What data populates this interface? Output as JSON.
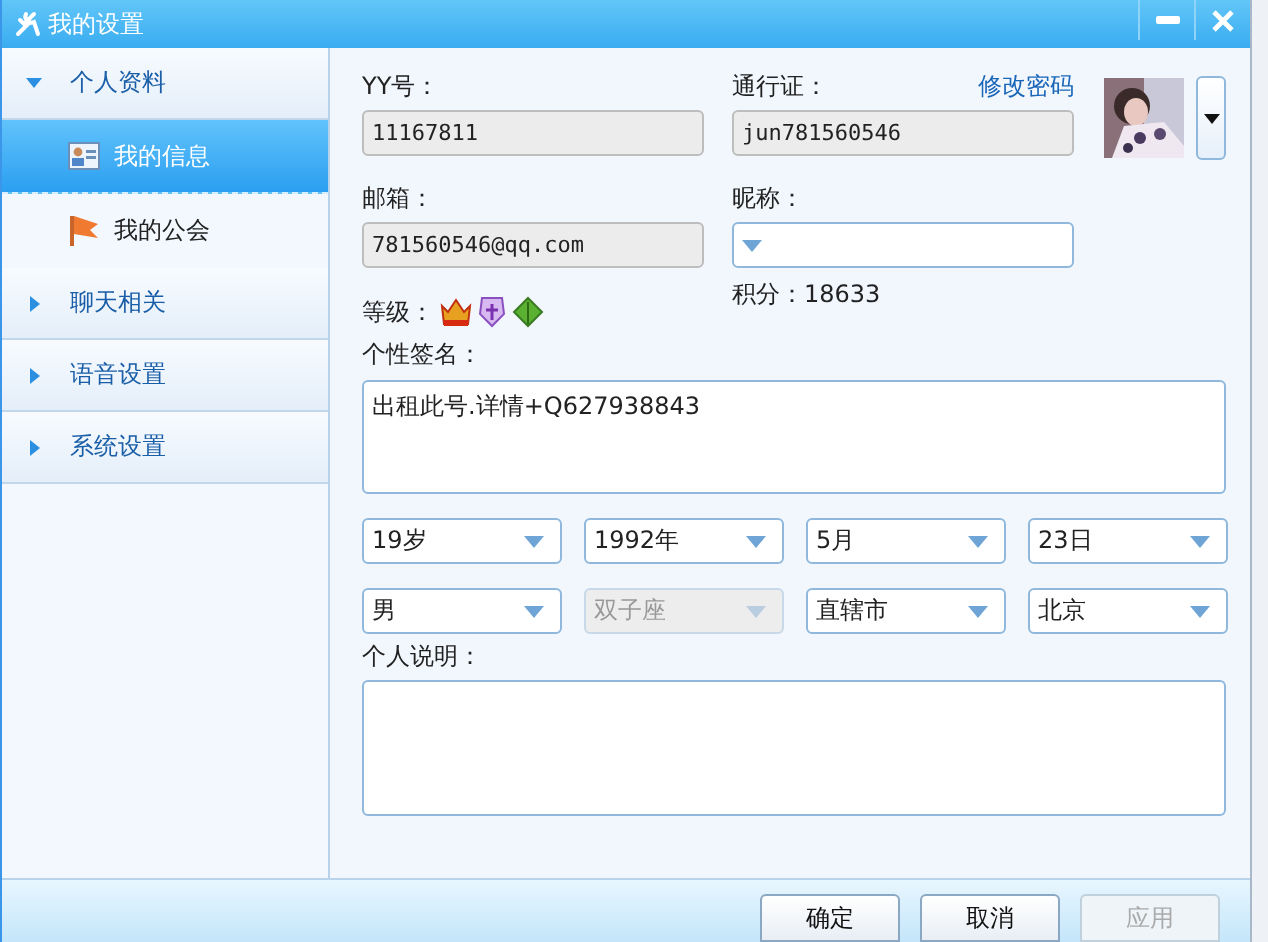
{
  "window": {
    "title": "我的设置"
  },
  "sidebar": {
    "groups": [
      {
        "label": "个人资料",
        "expanded": true,
        "children": [
          {
            "label": "我的信息",
            "kind": "card",
            "selected": true
          },
          {
            "label": "我的公会",
            "kind": "flag",
            "selected": false
          }
        ]
      },
      {
        "label": "聊天相关",
        "expanded": false
      },
      {
        "label": "语音设置",
        "expanded": false
      },
      {
        "label": "系统设置",
        "expanded": false
      }
    ]
  },
  "profile": {
    "yy": {
      "label": "YY号：",
      "value": "11167811"
    },
    "passport": {
      "label": "通行证：",
      "value": "jun781560546",
      "link": "修改密码"
    },
    "email": {
      "label": "邮箱：",
      "value": "781560546@qq.com"
    },
    "nickname": {
      "label": "昵称："
    },
    "level": {
      "label": "等级："
    },
    "points": "积分：18633",
    "signature": {
      "label": "个性签名：",
      "value": "出租此号.详情+Q627938843"
    },
    "selects": [
      [
        {
          "value": "19岁",
          "disabled": false
        },
        {
          "value": "1992年",
          "disabled": false
        },
        {
          "value": "5月",
          "disabled": false
        },
        {
          "value": "23日",
          "disabled": false
        }
      ],
      [
        {
          "value": "男",
          "disabled": false
        },
        {
          "value": "双子座",
          "disabled": true
        },
        {
          "value": "直辖市",
          "disabled": false
        },
        {
          "value": "北京",
          "disabled": false
        }
      ]
    ],
    "description": {
      "label": "个人说明："
    }
  },
  "buttons": [
    {
      "label": "确定",
      "disabled": false
    },
    {
      "label": "取消",
      "disabled": false
    },
    {
      "label": "应用",
      "disabled": true
    }
  ]
}
